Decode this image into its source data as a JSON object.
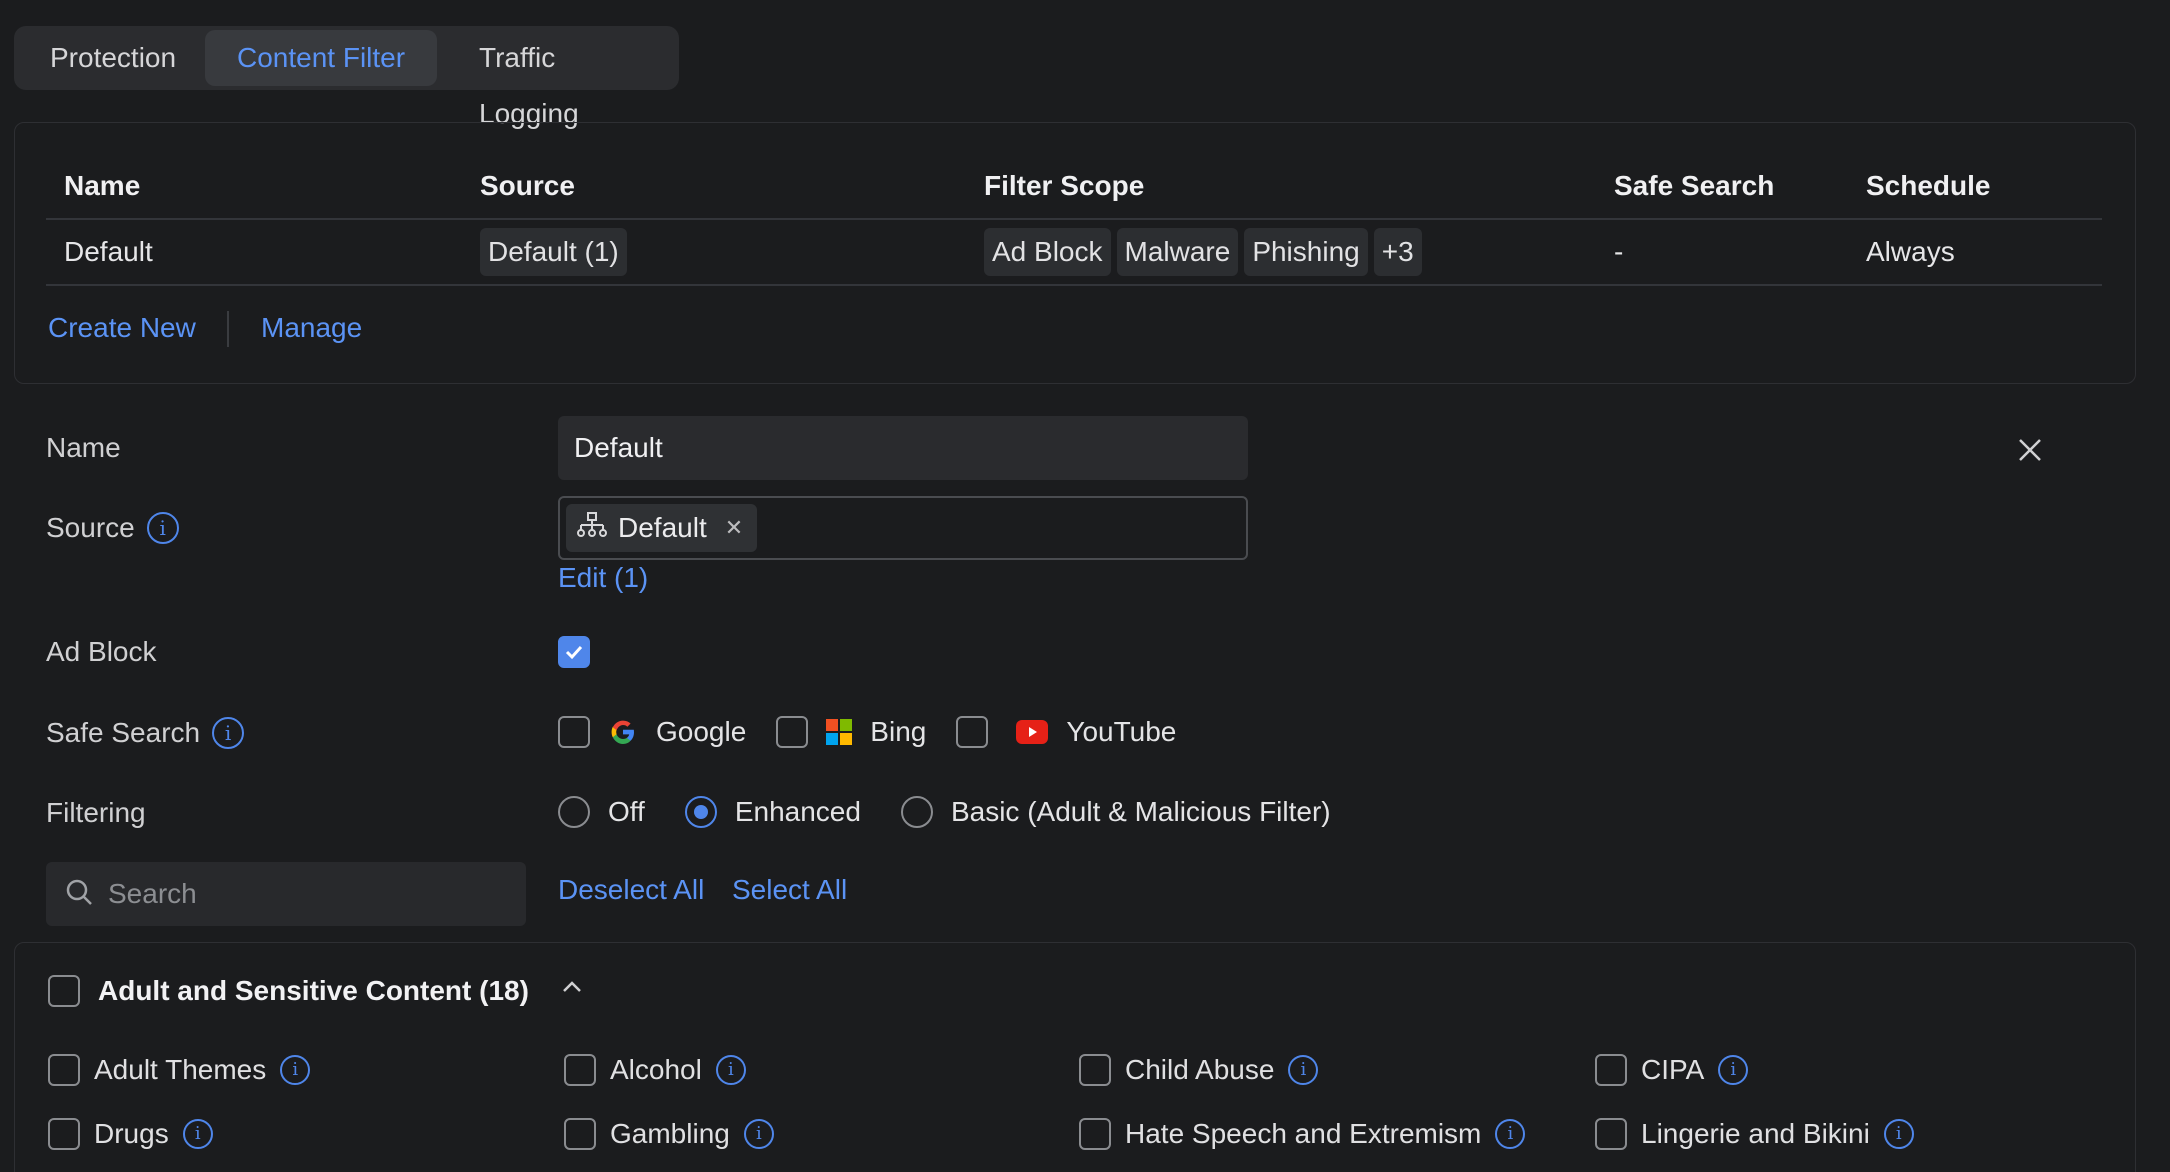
{
  "tabs": [
    {
      "label": "Protection"
    },
    {
      "label": "Content Filter"
    },
    {
      "label": "Traffic Logging"
    }
  ],
  "active_tab": "Content Filter",
  "table": {
    "headers": {
      "name": "Name",
      "source": "Source",
      "filter_scope": "Filter Scope",
      "safe_search": "Safe Search",
      "schedule": "Schedule"
    },
    "rows": [
      {
        "name": "Default",
        "source": "Default (1)",
        "filter_scope": [
          "Ad Block",
          "Malware",
          "Phishing",
          "+3"
        ],
        "safe_search": "-",
        "schedule": "Always"
      }
    ],
    "actions": {
      "create_new": "Create New",
      "manage": "Manage"
    }
  },
  "form": {
    "name_label": "Name",
    "name_value": "Default",
    "source_label": "Source",
    "source_chip": "Default",
    "source_edit": "Edit (1)",
    "adblock_label": "Ad Block",
    "adblock_checked": true,
    "safesearch_label": "Safe Search",
    "safesearch_options": [
      "Google",
      "Bing",
      "YouTube"
    ],
    "filtering_label": "Filtering",
    "filtering_options": [
      "Off",
      "Enhanced",
      "Basic (Adult & Malicious Filter)"
    ],
    "filtering_selected": "Enhanced",
    "search_placeholder": "Search",
    "deselect_all": "Deselect All",
    "select_all": "Select All"
  },
  "category": {
    "title": "Adult and Sensitive Content (18)",
    "items": [
      "Adult Themes",
      "Alcohol",
      "Child Abuse",
      "CIPA",
      "Drugs",
      "Gambling",
      "Hate Speech and Extremism",
      "Lingerie and Bikini"
    ]
  },
  "colors": {
    "accent": "#5b93f5",
    "background": "#1b1c1e"
  },
  "icons": [
    "close-icon",
    "info-icon",
    "network-icon",
    "remove-icon",
    "search-icon",
    "chevron-up-icon",
    "google-icon",
    "bing-icon",
    "youtube-icon",
    "checkmark-icon"
  ]
}
